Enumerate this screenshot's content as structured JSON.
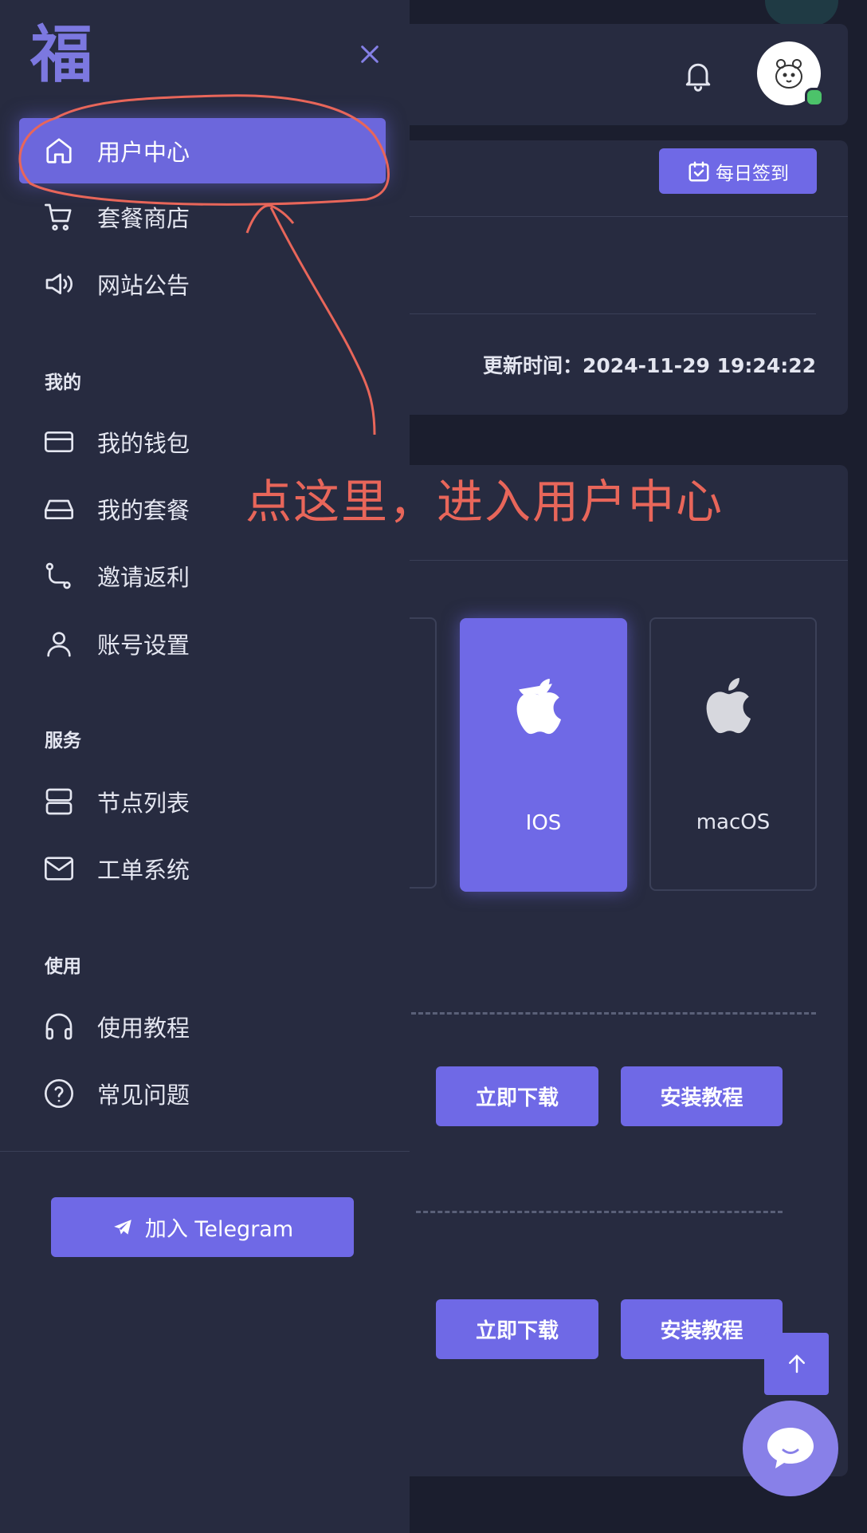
{
  "header": {
    "bell_icon": "bell-icon",
    "avatar_icon": "bear-avatar",
    "online_status_color": "#4cc36a"
  },
  "checkin": {
    "label": "每日签到",
    "icon": "calendar-check-icon"
  },
  "update": {
    "label": "更新时间：2024-11-29 19:24:22"
  },
  "platforms": [
    {
      "label": "IOS",
      "icon": "apple-icon",
      "selected": true
    },
    {
      "label": "macOS",
      "icon": "apple-icon",
      "selected": false
    }
  ],
  "downloads": [
    {
      "download_label": "立即下载",
      "tutorial_label": "安装教程"
    },
    {
      "download_label": "立即下载",
      "tutorial_label": "安装教程"
    }
  ],
  "sidebar": {
    "logo": "福",
    "top_items": [
      {
        "label": "用户中心",
        "icon": "home-icon",
        "active": true
      },
      {
        "label": "套餐商店",
        "icon": "cart-icon"
      },
      {
        "label": "网站公告",
        "icon": "speaker-icon"
      }
    ],
    "sections": [
      {
        "title": "我的",
        "items": [
          {
            "label": "我的钱包",
            "icon": "credit-card-icon"
          },
          {
            "label": "我的套餐",
            "icon": "drive-icon"
          },
          {
            "label": "邀请返利",
            "icon": "route-icon"
          },
          {
            "label": "账号设置",
            "icon": "user-icon"
          }
        ]
      },
      {
        "title": "服务",
        "items": [
          {
            "label": "节点列表",
            "icon": "server-icon"
          },
          {
            "label": "工单系统",
            "icon": "mail-icon"
          }
        ]
      },
      {
        "title": "使用",
        "items": [
          {
            "label": "使用教程",
            "icon": "headphones-icon"
          },
          {
            "label": "常见问题",
            "icon": "question-circle-icon"
          }
        ]
      }
    ],
    "telegram_label": "加入 Telegram"
  },
  "annotation": {
    "text": "点这里，进入用户中心",
    "color": "#e8665a"
  },
  "colors": {
    "accent": "#6f69e6",
    "sidebar_bg": "#272b40",
    "page_bg": "#1b1e2e"
  }
}
